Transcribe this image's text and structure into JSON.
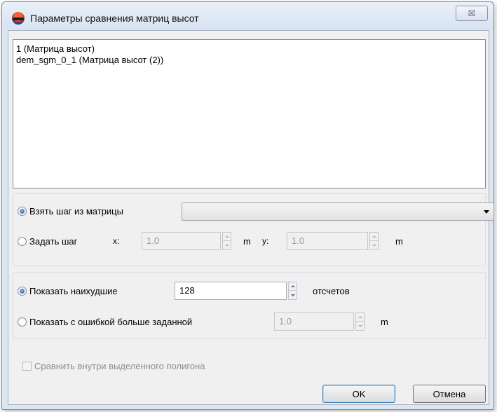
{
  "window": {
    "title": "Параметры сравнения матриц высот",
    "close_glyph": "☒"
  },
  "list": {
    "items": [
      "1 (Матрица высот)",
      "dem_sgm_0_1 (Матрица высот (2))"
    ]
  },
  "step": {
    "from_matrix_label": "Взять шаг из матрицы",
    "from_matrix_checked": true,
    "combo_value": "",
    "set_step_label": "Задать шаг",
    "set_step_checked": false,
    "x_label": "x:",
    "x_value": "1.0",
    "x_unit": "m",
    "y_label": "y:",
    "y_value": "1.0",
    "y_unit": "m"
  },
  "show": {
    "worst_label": "Показать наихудшие",
    "worst_checked": true,
    "worst_value": "128",
    "worst_unit": "отсчетов",
    "error_label": "Показать с ошибкой больше заданной",
    "error_checked": false,
    "error_value": "1.0",
    "error_unit": "m"
  },
  "polygon_checkbox": {
    "label": "Сравнить внутри выделенного полигона",
    "checked": false
  },
  "buttons": {
    "ok": "OK",
    "cancel": "Отмена"
  }
}
